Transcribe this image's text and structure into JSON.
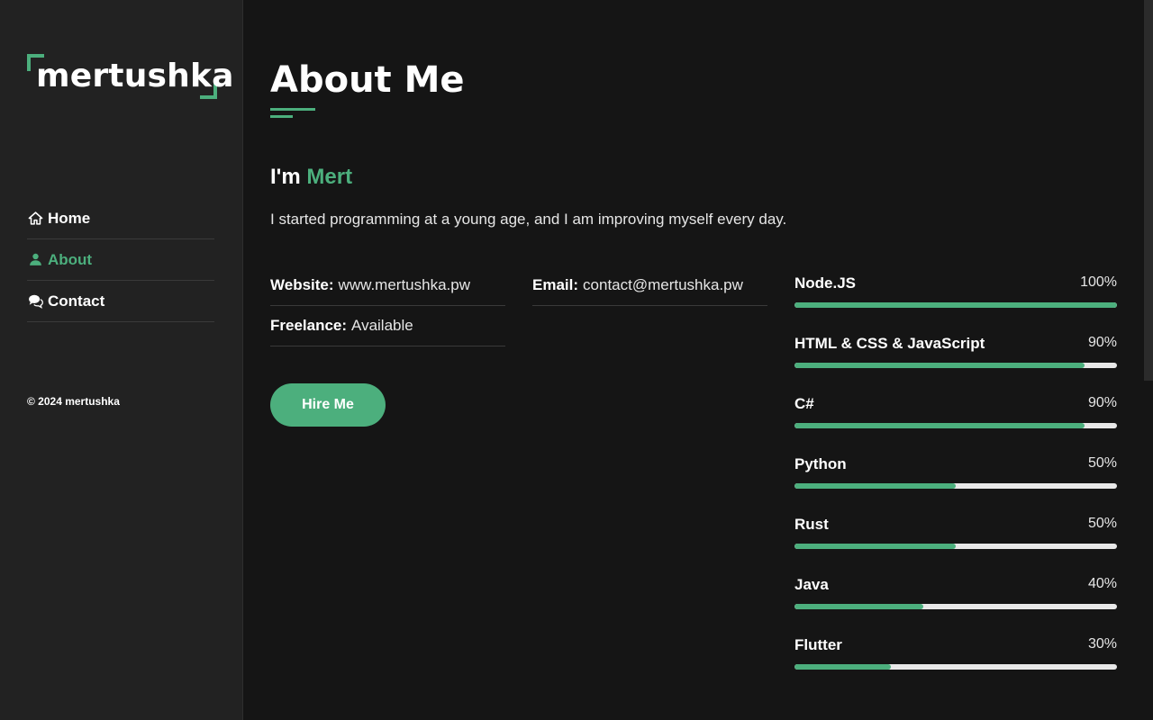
{
  "sidebar": {
    "logo": "mertushka",
    "nav": [
      {
        "label": "Home",
        "icon": "home-icon",
        "active": false
      },
      {
        "label": "About",
        "icon": "user-icon",
        "active": true
      },
      {
        "label": "Contact",
        "icon": "comments-icon",
        "active": false
      }
    ],
    "copyright": "© 2024 mertushka"
  },
  "main": {
    "title": "About Me",
    "intro_prefix": "I'm",
    "intro_name": "Mert",
    "intro_text": "I started programming at a young age, and I am improving myself every day.",
    "info": {
      "website_label": "Website:",
      "website_value": "www.mertushka.pw",
      "email_label": "Email:",
      "email_value": "contact@mertushka.pw",
      "freelance_label": "Freelance:",
      "freelance_value": "Available"
    },
    "hire_button": "Hire Me",
    "skills": [
      {
        "name": "Node.JS",
        "percent_label": "100%",
        "value": 100
      },
      {
        "name": "HTML & CSS & JavaScript",
        "percent_label": "90%",
        "value": 90
      },
      {
        "name": "C#",
        "percent_label": "90%",
        "value": 90
      },
      {
        "name": "Python",
        "percent_label": "50%",
        "value": 50
      },
      {
        "name": "Rust",
        "percent_label": "50%",
        "value": 50
      },
      {
        "name": "Java",
        "percent_label": "40%",
        "value": 40
      },
      {
        "name": "Flutter",
        "percent_label": "30%",
        "value": 30
      }
    ]
  },
  "colors": {
    "accent": "#4caf7d",
    "background": "#151515",
    "sidebar": "#222222"
  }
}
